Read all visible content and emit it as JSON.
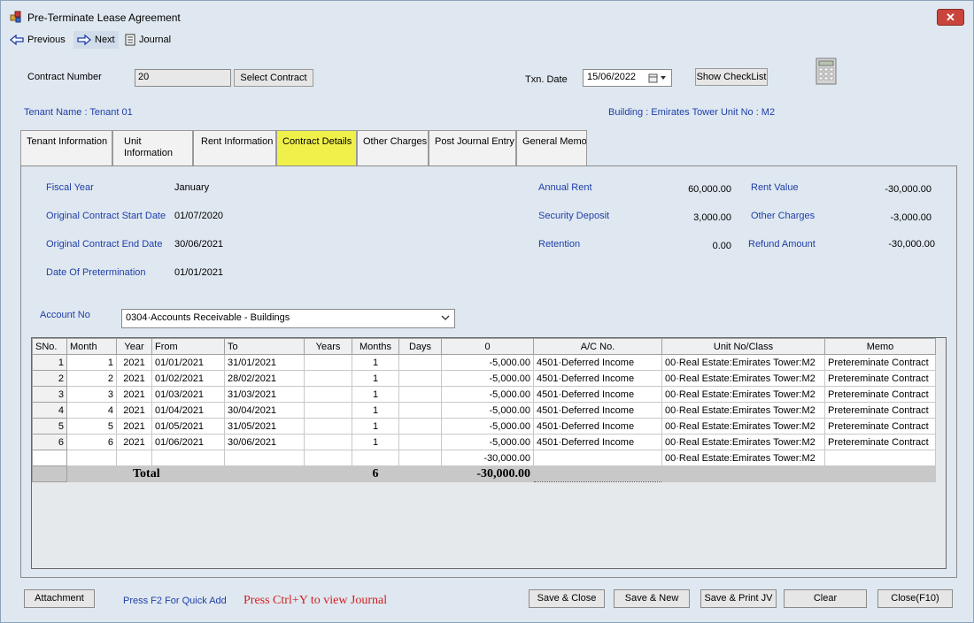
{
  "window": {
    "title": "Pre-Terminate Lease Agreement",
    "close_label": "✕"
  },
  "toolbar": {
    "previous": "Previous",
    "next": "Next",
    "journal": "Journal"
  },
  "header": {
    "contract_number_label": "Contract Number",
    "contract_number_value": "20",
    "select_contract": "Select Contract",
    "txn_date_label": "Txn. Date",
    "txn_date_value": "15/06/2022",
    "show_checklist": "Show CheckList",
    "tenant_name": "Tenant Name : Tenant 01",
    "building_unit": "Building : Emirates Tower  Unit No : M2"
  },
  "tabs": [
    "Tenant Information",
    "Unit Information",
    "Rent Information",
    "Contract Details",
    "Other Charges",
    "Post Journal Entry",
    "General Memo"
  ],
  "details": {
    "fiscal_year_label": "Fiscal Year",
    "fiscal_year": "January",
    "start_label": "Original Contract Start Date",
    "start": "01/07/2020",
    "end_label": "Original Contract End Date",
    "end": "30/06/2021",
    "pretermination_label": "Date Of Pretermination",
    "pretermination": "01/01/2021",
    "annual_rent_label": "Annual Rent",
    "annual_rent": "60,000.00",
    "security_deposit_label": "Security Deposit",
    "security_deposit": "3,000.00",
    "retention_label": "Retention",
    "retention": "0.00",
    "rent_value_label": "Rent Value",
    "rent_value": "-30,000.00",
    "other_charges_label": "Other Charges",
    "other_charges": "-3,000.00",
    "refund_amount_label": "Refund Amount",
    "refund_amount": "-30,000.00"
  },
  "account": {
    "label": "Account No",
    "value": "0304·Accounts Receivable - Buildings"
  },
  "table": {
    "columns": [
      "SNo.",
      "Month",
      "Year",
      "From",
      "To",
      "Years",
      "Months",
      "Days",
      "0",
      "A/C No.",
      "Unit No/Class",
      "Memo"
    ],
    "rows": [
      [
        "1",
        "1",
        "2021",
        "01/01/2021",
        "31/01/2021",
        "",
        "1",
        "",
        "-5,000.00",
        "4501·Deferred Income",
        "00·Real Estate:Emirates Tower:M2",
        "Pretereminate Contract"
      ],
      [
        "2",
        "2",
        "2021",
        "01/02/2021",
        "28/02/2021",
        "",
        "1",
        "",
        "-5,000.00",
        "4501·Deferred Income",
        "00·Real Estate:Emirates Tower:M2",
        "Pretereminate Contract"
      ],
      [
        "3",
        "3",
        "2021",
        "01/03/2021",
        "31/03/2021",
        "",
        "1",
        "",
        "-5,000.00",
        "4501·Deferred Income",
        "00·Real Estate:Emirates Tower:M2",
        "Pretereminate Contract"
      ],
      [
        "4",
        "4",
        "2021",
        "01/04/2021",
        "30/04/2021",
        "",
        "1",
        "",
        "-5,000.00",
        "4501·Deferred Income",
        "00·Real Estate:Emirates Tower:M2",
        "Pretereminate Contract"
      ],
      [
        "5",
        "5",
        "2021",
        "01/05/2021",
        "31/05/2021",
        "",
        "1",
        "",
        "-5,000.00",
        "4501·Deferred Income",
        "00·Real Estate:Emirates Tower:M2",
        "Pretereminate Contract"
      ],
      [
        "6",
        "6",
        "2021",
        "01/06/2021",
        "30/06/2021",
        "",
        "1",
        "",
        "-5,000.00",
        "4501·Deferred Income",
        "00·Real Estate:Emirates Tower:M2",
        "Pretereminate Contract"
      ],
      [
        "",
        "",
        "",
        "",
        "",
        "",
        "",
        "",
        "-30,000.00",
        "",
        "00·Real Estate:Emirates Tower:M2",
        ""
      ]
    ],
    "total": {
      "label": "Total",
      "months": "6",
      "amount": "-30,000.00"
    }
  },
  "footer": {
    "attachment": "Attachment",
    "quick_add_hint": "Press F2 For Quick Add",
    "journal_hint": "Press Ctrl+Y to view Journal",
    "save_close": "Save & Close",
    "save_new": "Save & New",
    "save_print": "Save & Print JV",
    "clear": "Clear",
    "close": "Close(F10)"
  }
}
